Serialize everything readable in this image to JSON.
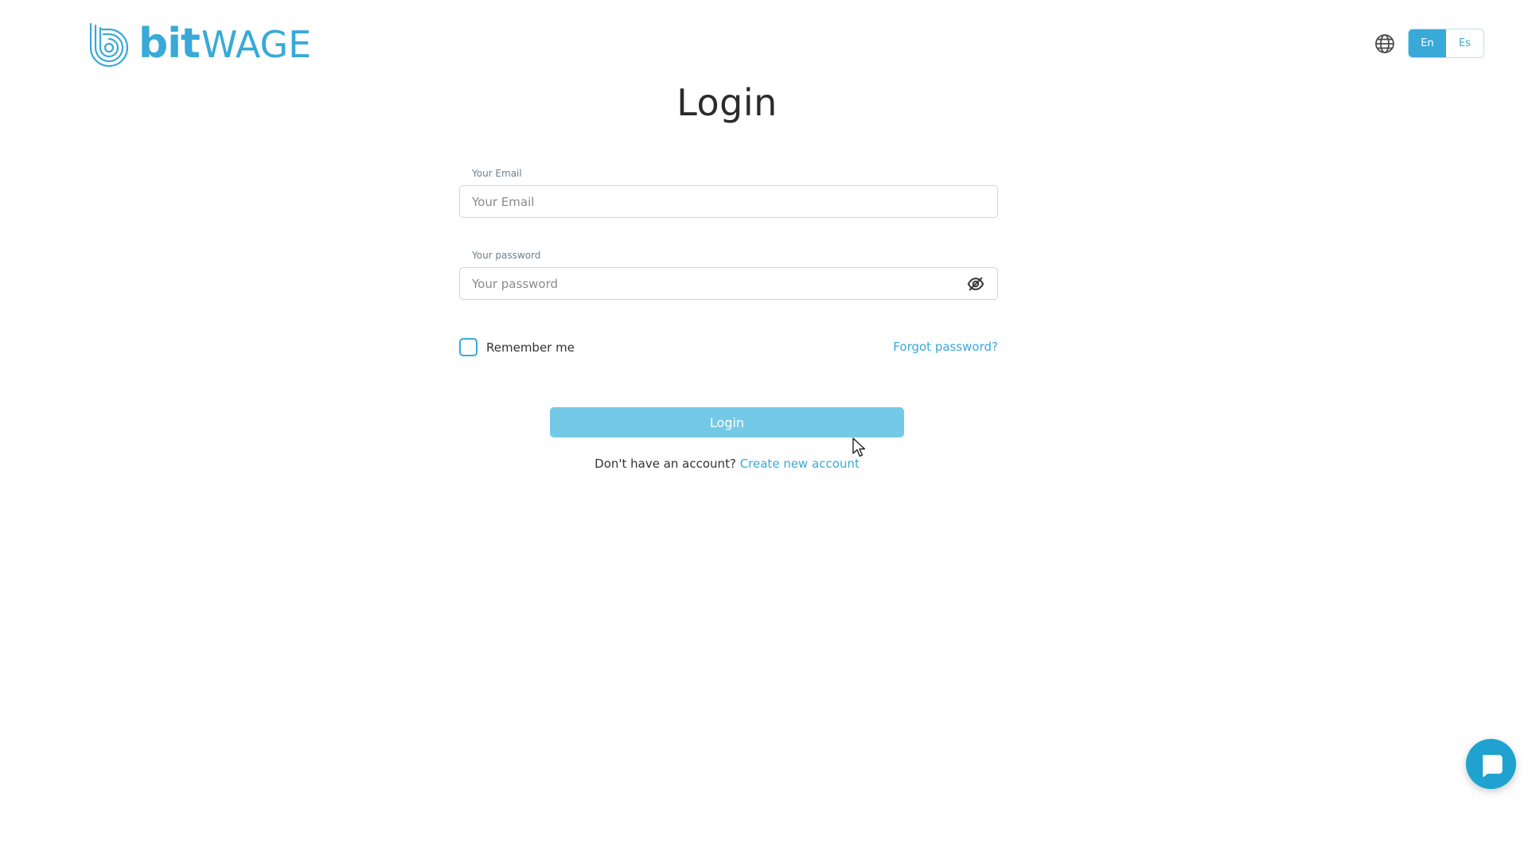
{
  "brand": {
    "logo_bit": "bit",
    "logo_wage": "WAGE",
    "logo_icon": "bitwage-logo-icon",
    "color": "#39a9d8"
  },
  "language": {
    "icon": "globe-icon",
    "options": [
      {
        "label": "En",
        "active": true
      },
      {
        "label": "Es",
        "active": false
      }
    ]
  },
  "login": {
    "title": "Login",
    "email": {
      "label": "Your Email",
      "placeholder": "Your Email",
      "value": ""
    },
    "password": {
      "label": "Your password",
      "placeholder": "Your password",
      "value": "",
      "toggle_icon": "eye-off-icon"
    },
    "remember_label": "Remember me",
    "forgot_label": "Forgot password?",
    "submit_label": "Login",
    "signup_prompt": "Don't have an account?",
    "signup_link": "Create new account"
  },
  "chat": {
    "icon": "chat-bubble-icon",
    "color": "#1fa2d0"
  },
  "colors": {
    "accent": "#39a9d8",
    "button": "#74c9e7",
    "border": "#cfd6db"
  }
}
